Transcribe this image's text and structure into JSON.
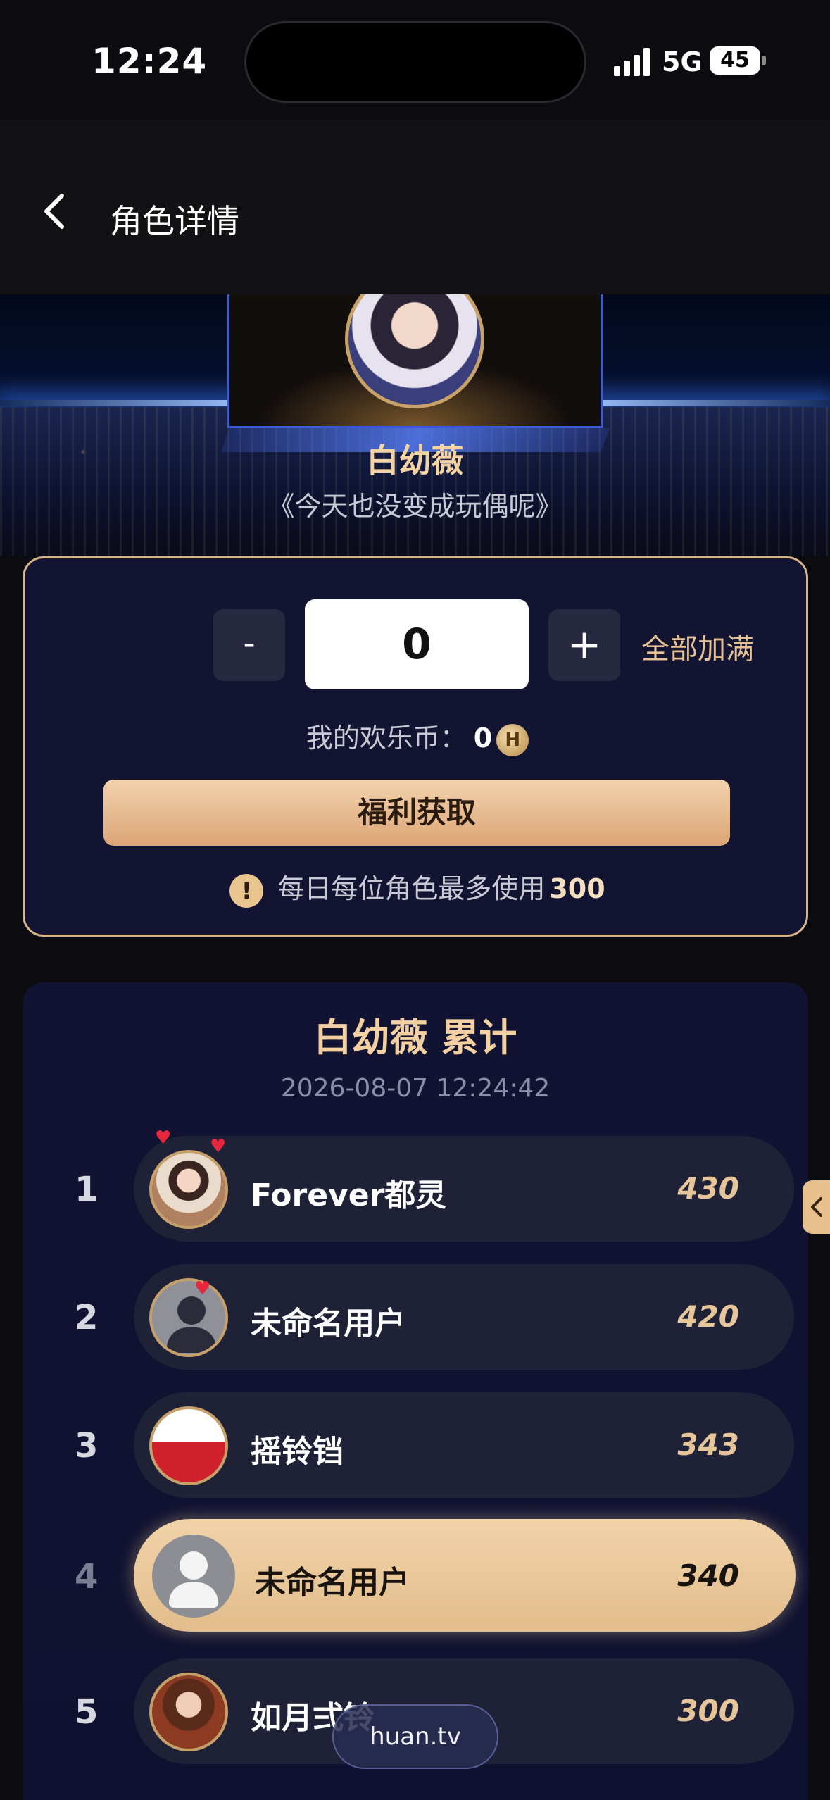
{
  "status_bar": {
    "time": "12:24",
    "network": "5G",
    "battery": "45"
  },
  "header": {
    "title": "角色详情",
    "back_icon": "chevron-left-icon"
  },
  "hero": {
    "character_name": "白幼薇",
    "drama_title": "《今天也没变成玩偶呢》"
  },
  "support": {
    "minus_label": "-",
    "amount_value": "0",
    "plus_label": "+",
    "fill_all_label": "全部加满",
    "coin_label": "我的欢乐币：",
    "coin_value": "0",
    "coin_icon": "H",
    "benefit_button_label": "福利获取",
    "limit_text": "每日每位角色最多使用",
    "limit_value": "300",
    "warning_icon": "!"
  },
  "ranking": {
    "title": "白幼薇 累计",
    "timestamp": "2026-08-07 12:24:42",
    "rows": [
      {
        "rank": "1",
        "name": "Forever都灵",
        "score": "430"
      },
      {
        "rank": "2",
        "name": "未命名用户",
        "score": "420"
      },
      {
        "rank": "3",
        "name": "摇铃铛",
        "score": "343"
      },
      {
        "rank": "4",
        "name": "未命名用户",
        "score": "340"
      },
      {
        "rank": "5",
        "name": "如月弍铃",
        "score": "300"
      }
    ]
  },
  "watermark": "huan.tv",
  "colors": {
    "accent_gold": "#e6c193",
    "card_bg": "#121431",
    "highlight_row": "#e2bd8c"
  }
}
